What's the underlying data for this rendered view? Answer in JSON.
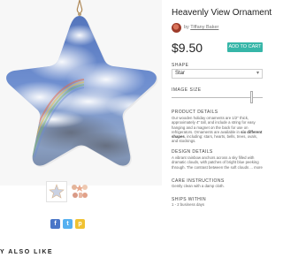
{
  "product": {
    "title": "Heavenly View Ornament",
    "by_prefix": "by",
    "artist": "Tiffany Baker",
    "price": "$9.50",
    "add_to_cart": "ADD TO CART"
  },
  "options": {
    "shape_label": "SHAPE",
    "shape_value": "Star",
    "size_label": "IMAGE SIZE",
    "image_size_fraction": 0.88
  },
  "product_details": {
    "heading": "PRODUCT DETAILS",
    "text_before": "Our wooden holiday ornaments are 1/2\" thick, approximately 4\" tall, and include a string for easy hanging and a magnet on the back for use on refrigerators.  Ornaments are available in ",
    "text_bold": "six different shapes",
    "text_after": ", including: stars, hearts, bells, trees, ovals, and stockings."
  },
  "design_details": {
    "heading": "DESIGN DETAILS",
    "text": "A vibrant rainbow anchors across a sky filled with dramatic clouds, with patches of bright blue peeking through. The contrast between the soft clouds ... more"
  },
  "care": {
    "heading": "CARE INSTRUCTIONS",
    "text": "Gently clean with a damp cloth."
  },
  "ships": {
    "heading": "SHIPS WITHIN",
    "text": "1 - 2 business days"
  },
  "share": {
    "facebook": "f",
    "twitter": "t",
    "pinterest": "p"
  },
  "icons": [
    "facebook-icon",
    "twitter-icon",
    "pinterest-icon",
    "chevron-down-icon"
  ],
  "colors": {
    "accent": "#36b6a8",
    "facebook": "#4a76c7",
    "twitter": "#56b0f0",
    "pinterest": "#f0c232"
  },
  "footer": {
    "also_like": "Y ALSO LIKE"
  }
}
